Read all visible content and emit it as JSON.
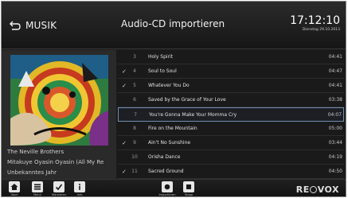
{
  "header": {
    "back_label": "MUSIK",
    "title": "Audio-CD importieren",
    "time": "17:12:10",
    "date": "Dienstag 29.10.2013"
  },
  "album": {
    "artist": "The Neville Brothers",
    "album": "Mitakuye Oyasin Oyasin (All My Re",
    "year": "Unbekanntes Jahr"
  },
  "tracks": [
    {
      "checked": false,
      "num": "3",
      "name": "Holy Spirit",
      "duration": "04:41",
      "selected": false
    },
    {
      "checked": true,
      "num": "4",
      "name": "Soul to Soul",
      "duration": "04:47",
      "selected": false
    },
    {
      "checked": true,
      "num": "5",
      "name": "Whatever You Do",
      "duration": "04:41",
      "selected": false
    },
    {
      "checked": false,
      "num": "6",
      "name": "Saved by the Grace of Your Love",
      "duration": "03:38",
      "selected": false
    },
    {
      "checked": false,
      "num": "7",
      "name": "You're Gonna Make Your Momma Cry",
      "duration": "04:07",
      "selected": true
    },
    {
      "checked": false,
      "num": "8",
      "name": "Fire on the Mountain",
      "duration": "05:00",
      "selected": false
    },
    {
      "checked": true,
      "num": "9",
      "name": "Ain't No Sunshine",
      "duration": "03:44",
      "selected": false
    },
    {
      "checked": false,
      "num": "10",
      "name": "Orisha Dance",
      "duration": "04:19",
      "selected": false
    },
    {
      "checked": true,
      "num": "11",
      "name": "Sacred Ground",
      "duration": "04:50",
      "selected": false
    }
  ],
  "check_glyph": "✓",
  "toolbar": {
    "start": "Start",
    "menu": "Menü",
    "mark": "Markieren",
    "info": "Info",
    "import": "Importieren",
    "stop": "Stopp"
  },
  "logo": {
    "pre": "RE",
    "post": "VOX"
  },
  "colors": {
    "selection_border": "#6f8fb3",
    "background": "#1a1a1a"
  }
}
